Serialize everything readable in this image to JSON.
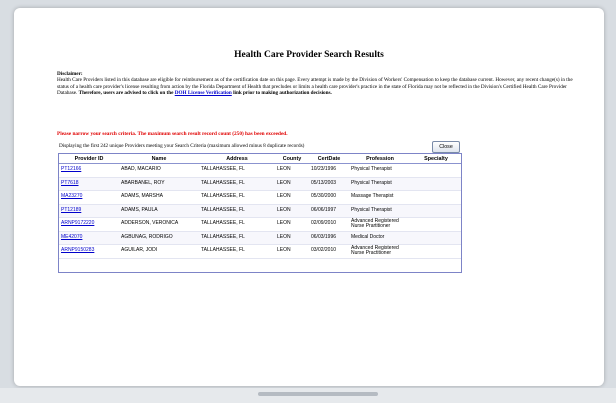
{
  "title": "Health Care Provider Search Results",
  "disclaimer": {
    "heading": "Disclaimer:",
    "body": "Health Care Providers listed in this database are eligible for reimbursement as of the certification date on this page. Every attempt is made by the Division of Workers' Compensation to keep the database current. However, any recent change(s) in the status of a health care provider's license resulting from action by the Florida Department of Health that precludes or limits a health care provider's practice in the state of Florida may not be reflected in the Division's Certified Health Care Provider Database.",
    "strong": "Therefore, users are advised to click on the",
    "link_text": "DOH License Verification",
    "tail": "link prior to making authorization decisions."
  },
  "warning": "Please narrow your search criteria. The maximum search result record count (250) has been exceeded.",
  "displaying": "Displaying the first 242 unique Providers meeting your Search Criteria (maximum allowed minus 8 duplicate records)",
  "close_label": "Close",
  "table": {
    "columns": [
      "Provider ID",
      "Name",
      "Address",
      "County",
      "CertDate",
      "Profession",
      "Specialty"
    ],
    "rows": [
      {
        "id": "PT12166",
        "name": "ABAD, MACARIO",
        "address": "TALLAHASSEE, FL",
        "county": "LEON",
        "date": "10/23/1996",
        "profession": "Physical Therapist",
        "specialty": ""
      },
      {
        "id": "PT7618",
        "name": "ABARBANEL, ROY",
        "address": "TALLAHASSEE, FL",
        "county": "LEON",
        "date": "05/13/2003",
        "profession": "Physical Therapist",
        "specialty": ""
      },
      {
        "id": "MA23270",
        "name": "ADAMS, MARSHA",
        "address": "TALLAHASSEE, FL",
        "county": "LEON",
        "date": "05/30/2000",
        "profession": "Massage Therapist",
        "specialty": ""
      },
      {
        "id": "PT12189",
        "name": "ADAMS, PAULA",
        "address": "TALLAHASSEE, FL",
        "county": "LEON",
        "date": "06/06/1997",
        "profession": "Physical Therapist",
        "specialty": ""
      },
      {
        "id": "ARNP9172220",
        "name": "ADDERSON, VERONICA",
        "address": "TALLAHASSEE, FL",
        "county": "LEON",
        "date": "02/09/2010",
        "profession": "Advanced Registered Nurse Prartitioner",
        "specialty": ""
      },
      {
        "id": "ME42070",
        "name": "AGBUNAG, RODRIGO",
        "address": "TALLAHASSEE, FL",
        "county": "LEON",
        "date": "06/03/1996",
        "profession": "Medical Doctor",
        "specialty": ""
      },
      {
        "id": "ARNP9150283",
        "name": "AGUILAR, JODI",
        "address": "TALLAHASSEE, FL",
        "county": "LEON",
        "date": "03/02/2010",
        "profession": "Advanced Registered Nurse Practitioner",
        "specialty": ""
      }
    ]
  }
}
